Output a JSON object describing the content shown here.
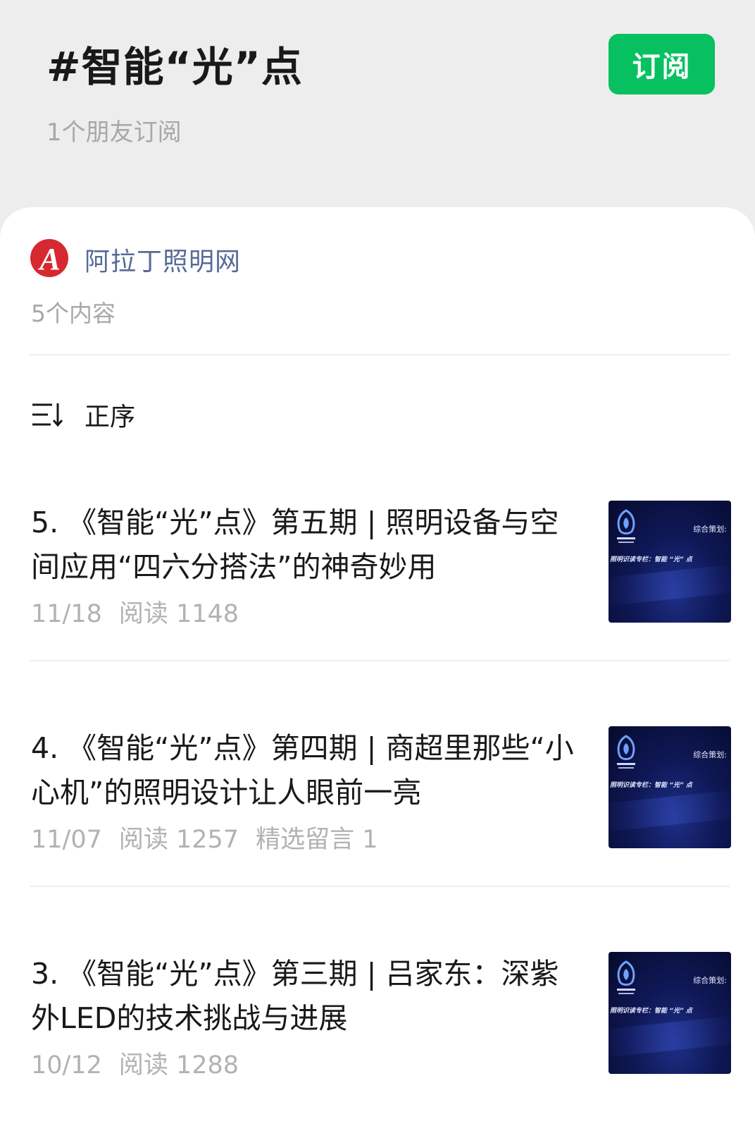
{
  "header": {
    "title": "#智能“光”点",
    "subscribers": "1个朋友订阅",
    "subscribe_button": "订阅"
  },
  "account": {
    "name": "阿拉丁照明网",
    "content_count": "5个内容",
    "logo_letter": "A"
  },
  "sort": {
    "label": "正序",
    "icon": "sort-icon"
  },
  "articles": [
    {
      "title": "5. 《智能“光”点》第五期 | 照明设备与空间应用“四六分搭法”的神奇妙用",
      "date": "11/18",
      "reads": "阅读 1148",
      "extra": "",
      "thumb_text1": "综合策划:",
      "thumb_text2": "照明识读专栏：智能 “光” 点"
    },
    {
      "title": "4. 《智能“光”点》第四期 | 商超里那些“小心机”的照明设计让人眼前一亮",
      "date": "11/07",
      "reads": "阅读 1257",
      "extra": "精选留言 1",
      "thumb_text1": "综合策划:",
      "thumb_text2": "照明识读专栏：智能 “光” 点"
    },
    {
      "title": "3. 《智能“光”点》第三期 | 吕家东：深紫外LED的技术挑战与进展",
      "date": "10/12",
      "reads": "阅读 1288",
      "extra": "",
      "thumb_text1": "综合策划:",
      "thumb_text2": "照明识读专栏：智能 “光” 点"
    }
  ],
  "colors": {
    "accent_green": "#07c160",
    "link_blue": "#576b95",
    "logo_red": "#d7282f"
  }
}
